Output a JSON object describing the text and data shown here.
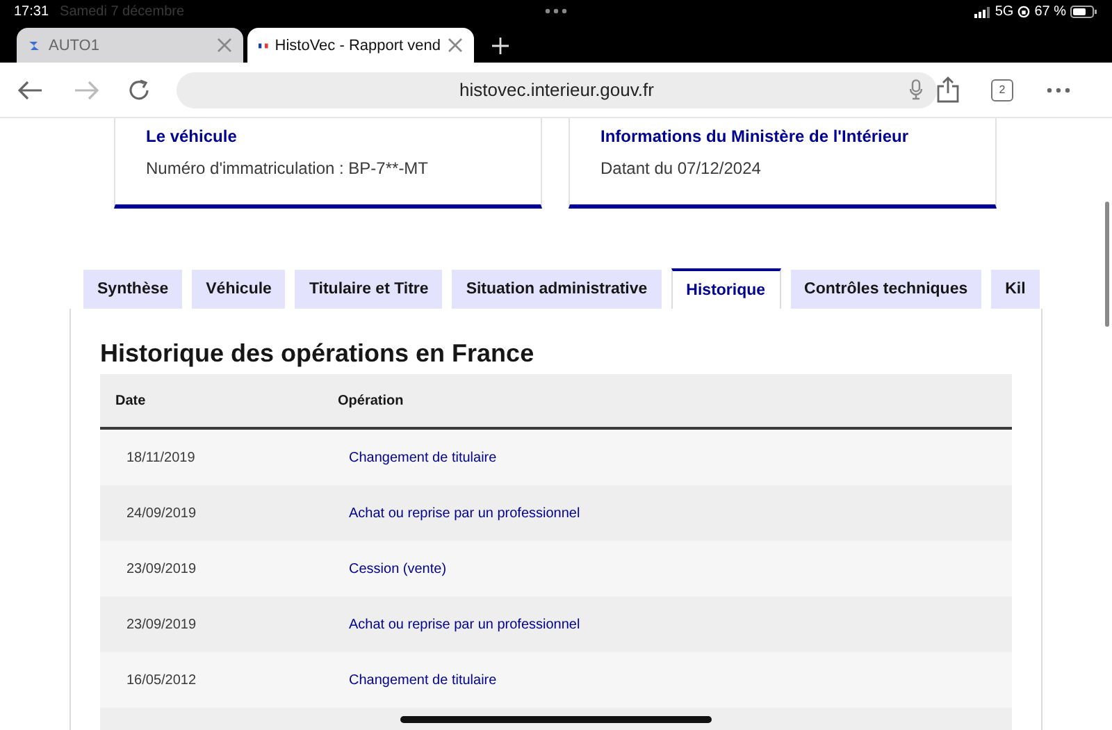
{
  "status_bar": {
    "time": "17:31",
    "date": "Samedi 7 décembre",
    "network": "5G",
    "battery": "67 %"
  },
  "browser_tabs": [
    {
      "title": "AUTO1",
      "selected": false
    },
    {
      "title": "HistoVec - Rapport vend",
      "selected": true
    }
  ],
  "address_bar": {
    "url": "histovec.interieur.gouv.fr",
    "tab_count": "2"
  },
  "cards": [
    {
      "title": "Le véhicule",
      "text": "Numéro d'immatriculation : BP-7**-MT"
    },
    {
      "title": "Informations du Ministère de l'Intérieur",
      "text": "Datant du 07/12/2024"
    }
  ],
  "tabs": [
    {
      "label": "Synthèse",
      "selected": false
    },
    {
      "label": "Véhicule",
      "selected": false
    },
    {
      "label": "Titulaire et Titre",
      "selected": false
    },
    {
      "label": "Situation administrative",
      "selected": false
    },
    {
      "label": "Historique",
      "selected": true
    },
    {
      "label": "Contrôles techniques",
      "selected": false
    },
    {
      "label": "Kil",
      "selected": false
    }
  ],
  "section_title": "Historique des opérations en France",
  "table": {
    "columns": [
      "Date",
      "Opération"
    ],
    "rows": [
      {
        "date": "18/11/2019",
        "operation": "Changement de titulaire"
      },
      {
        "date": "24/09/2019",
        "operation": "Achat ou reprise par un professionnel"
      },
      {
        "date": "23/09/2019",
        "operation": "Cession (vente)"
      },
      {
        "date": "23/09/2019",
        "operation": "Achat ou reprise par un professionnel"
      },
      {
        "date": "16/05/2012",
        "operation": "Changement de titulaire"
      }
    ]
  }
}
